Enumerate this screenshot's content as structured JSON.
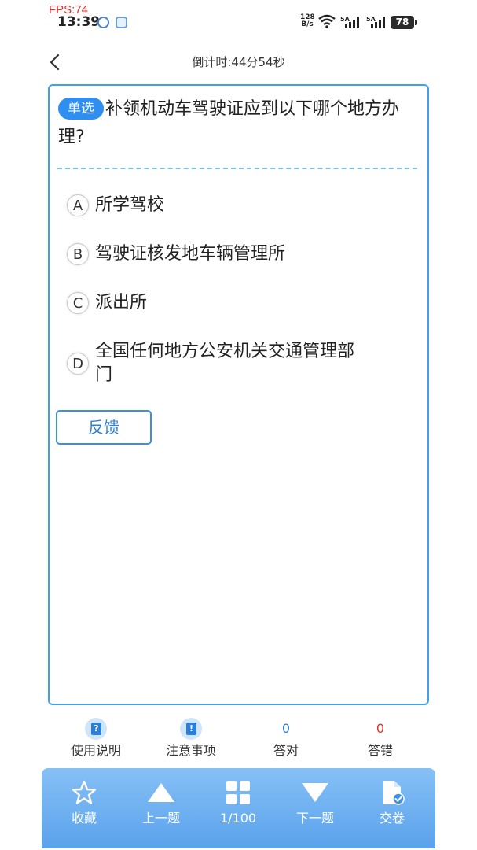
{
  "status_bar": {
    "fps": "FPS:74",
    "time": "13:39",
    "net_speed_value": "128",
    "net_speed_unit": "B/s",
    "signal_1": "5A",
    "signal_2": "5A",
    "battery": "78"
  },
  "header": {
    "timer": "倒计时:44分54秒"
  },
  "question": {
    "type_tag": "单选",
    "text": "补领机动车驾驶证应到以下哪个地方办理?",
    "options": [
      {
        "letter": "A",
        "text": "所学驾校"
      },
      {
        "letter": "B",
        "text": "驾驶证核发地车辆管理所"
      },
      {
        "letter": "C",
        "text": "派出所"
      },
      {
        "letter": "D",
        "text": "全国任何地方公安机关交通管理部门"
      }
    ],
    "feedback_label": "反馈"
  },
  "stats": {
    "instructions_label": "使用说明",
    "notes_label": "注意事项",
    "correct_count": "0",
    "correct_label": "答对",
    "wrong_count": "0",
    "wrong_label": "答错"
  },
  "bottom_nav": {
    "favorite": "收藏",
    "previous": "上一题",
    "progress": "1/100",
    "next": "下一题",
    "submit": "交卷"
  },
  "colors": {
    "accent": "#2f8ff0",
    "card_border": "#3fa2e8",
    "correct": "#2c7fd9",
    "wrong": "#e0322c",
    "bottom_bar": "#6aaef0"
  }
}
